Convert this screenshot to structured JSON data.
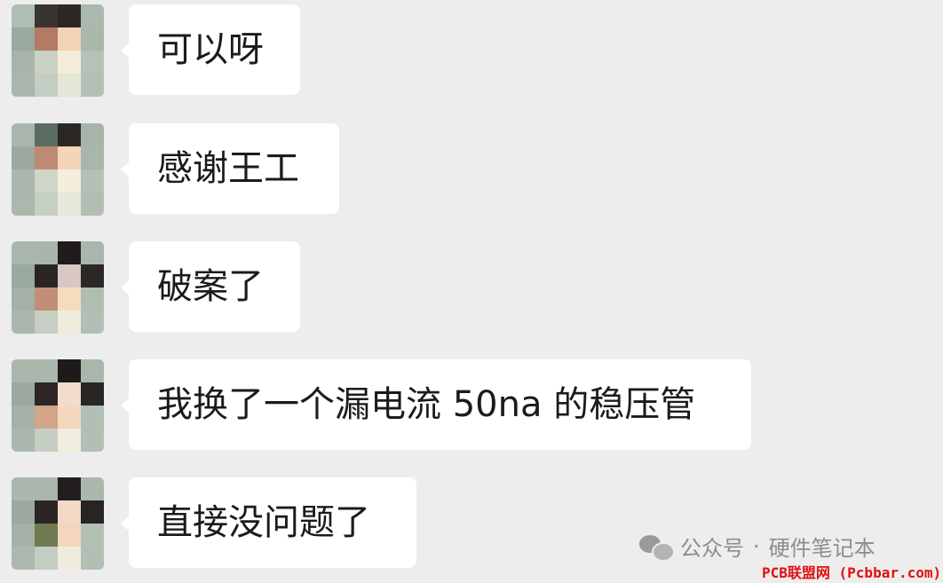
{
  "messages": [
    {
      "text": "可以呀"
    },
    {
      "text": "感谢王工"
    },
    {
      "text": "破案了"
    },
    {
      "text": "我换了一个漏电流 50na 的稳压管"
    },
    {
      "text": "直接没问题了"
    }
  ],
  "watermark": {
    "icon": "wechat-icon",
    "account": "公众号",
    "separator": "·",
    "name": "硬件笔记本"
  },
  "site_mark": "PCB联盟网 (Pcbbar.com)",
  "colors": {
    "background": "#ededed",
    "bubble": "#ffffff",
    "text": "#1b1b1b",
    "watermark": "#8d8d8d",
    "site_mark": "#e01010"
  }
}
